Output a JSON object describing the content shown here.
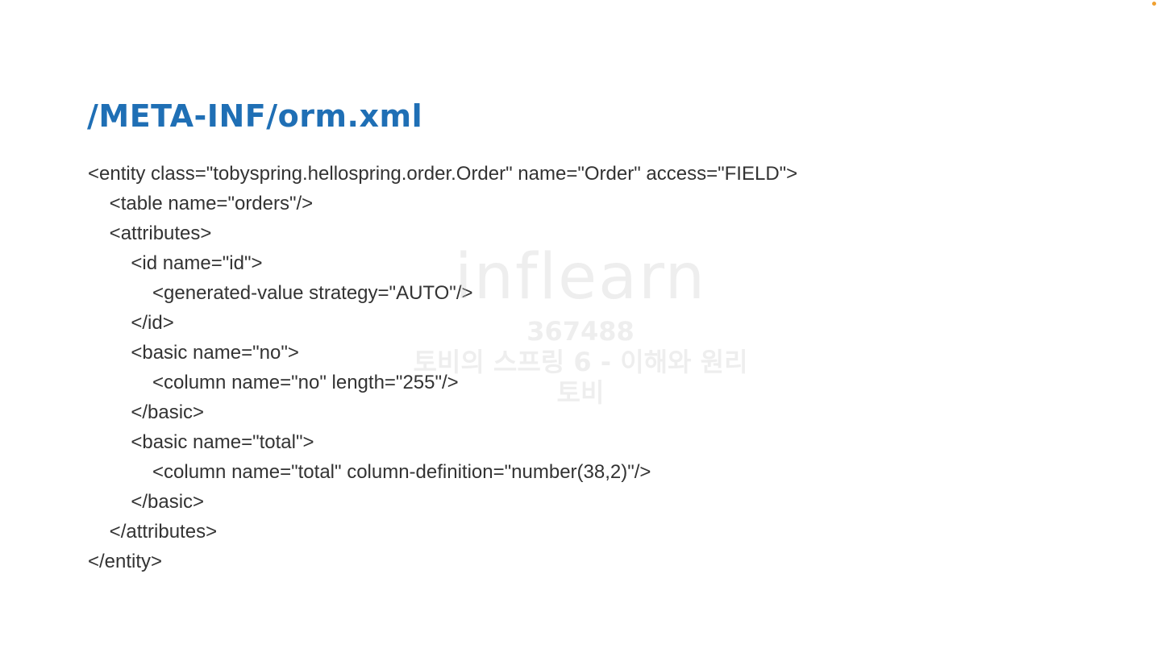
{
  "slide": {
    "title": "/META-INF/orm.xml",
    "code_lines": [
      "<entity class=\"tobyspring.hellospring.order.Order\" name=\"Order\" access=\"FIELD\">",
      "    <table name=\"orders\"/>",
      "    <attributes>",
      "        <id name=\"id\">",
      "            <generated-value strategy=\"AUTO\"/>",
      "        </id>",
      "        <basic name=\"no\">",
      "            <column name=\"no\" length=\"255\"/>",
      "        </basic>",
      "        <basic name=\"total\">",
      "            <column name=\"total\" column-definition=\"number(38,2)\"/>",
      "        </basic>",
      "    </attributes>",
      "</entity>"
    ]
  },
  "watermark": {
    "logo": "inflearn",
    "id": "367488",
    "course": "토비의 스프링 6 - 이해와 원리",
    "author": "토비"
  },
  "colors": {
    "title": "#1f6fb5",
    "code_text": "#333333",
    "background": "#ffffff"
  }
}
